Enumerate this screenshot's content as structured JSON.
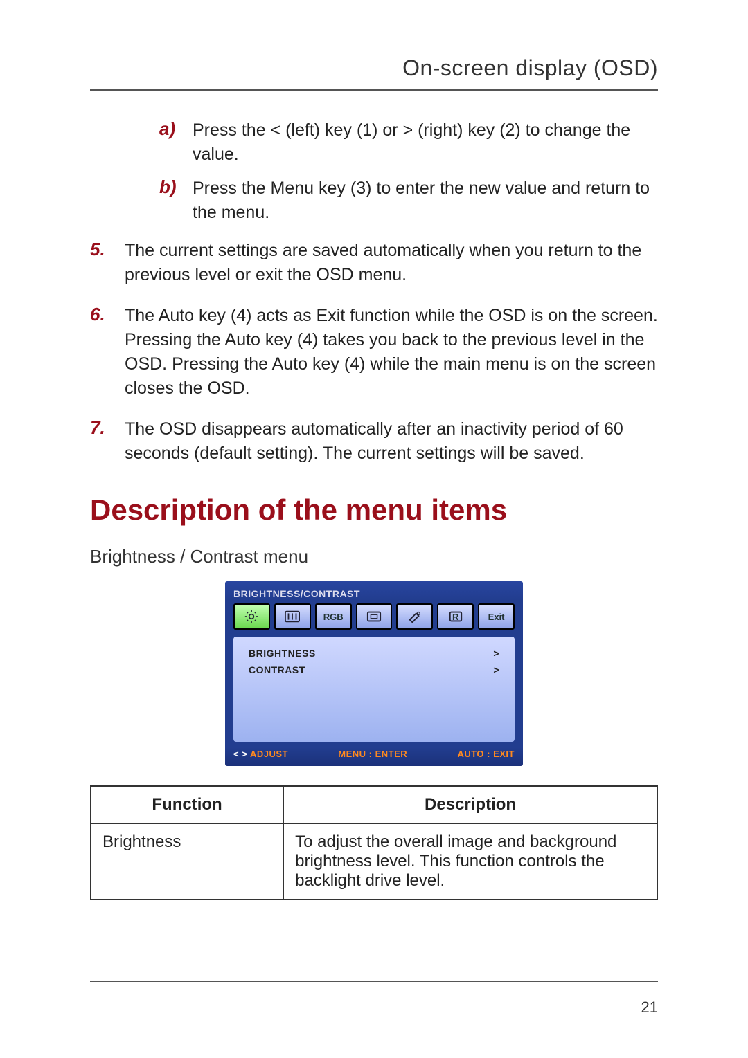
{
  "header": {
    "title": "On-screen display (OSD)"
  },
  "sub_steps": [
    {
      "marker": "a)",
      "text": "Press the < (left) key (1) or > (right) key (2) to change the value."
    },
    {
      "marker": "b)",
      "text": "Press the Menu key (3) to enter the new value and return to the menu."
    }
  ],
  "steps": [
    {
      "marker": "5.",
      "text": "The current settings are saved automatically when you return to the previous level or exit the OSD menu."
    },
    {
      "marker": "6.",
      "text": "The Auto key (4) acts as Exit function while the OSD is on the screen. Pressing the Auto key (4) takes you back to the previous level in the OSD. Pressing the Auto key (4) while the main menu is on the screen closes the OSD."
    },
    {
      "marker": "7.",
      "text": "The OSD disappears automatically after an inactivity period of 60 seconds (default setting). The current settings will be saved."
    }
  ],
  "section_heading": "Description of the menu items",
  "subsection_heading": "Brightness / Contrast menu",
  "osd": {
    "title": "BRIGHTNESS/CONTRAST",
    "tabs": {
      "rgb_label": "RGB",
      "r_label": "R",
      "exit_label": "Exit"
    },
    "rows": [
      {
        "label": "BRIGHTNESS",
        "value": ">"
      },
      {
        "label": "CONTRAST",
        "value": ">"
      }
    ],
    "footer": {
      "adjust_prefix": "< >",
      "adjust": "ADJUST",
      "menu": "MENU : ENTER",
      "auto": "AUTO : EXIT"
    }
  },
  "table": {
    "headers": {
      "function": "Function",
      "description": "Description"
    },
    "rows": [
      {
        "function": "Brightness",
        "description": "To adjust the overall image and background brightness level. This function controls the backlight drive level."
      }
    ]
  },
  "page_number": "21"
}
